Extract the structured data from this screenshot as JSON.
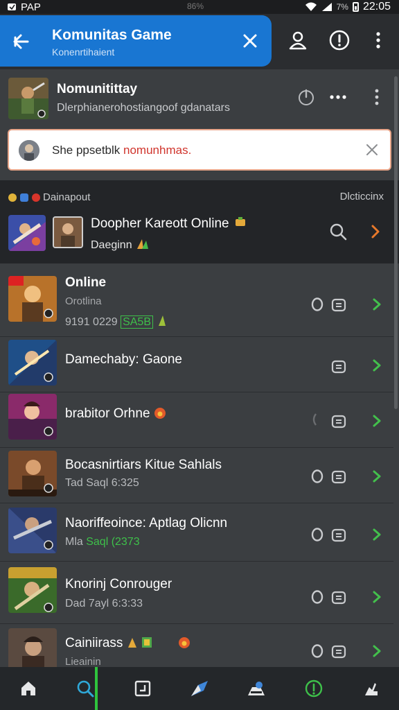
{
  "status_bar": {
    "carrier": "PAP",
    "center_text": "86%",
    "battery_percent": "7%",
    "time": "22:05"
  },
  "header": {
    "title": "Komunitas Game",
    "subtitle": "Konenrtihaient"
  },
  "community": {
    "title": "Nomunitittay",
    "subtitle": "Dlerphianerohostiangoof gdanatars"
  },
  "notice": {
    "text_prefix": "She ppsetblk ",
    "text_highlight": "nomunhmas."
  },
  "featured": {
    "header_left": "Dainapout",
    "header_right": "Dlcticcinx",
    "title": "Doopher Kareott Online",
    "subtitle": "Daeginn"
  },
  "games": [
    {
      "title": "Online",
      "sub": "Orotlina",
      "meta_prefix": "9191 0229 ",
      "meta_green": "SA5B",
      "has_o": true
    },
    {
      "title": "Damechaby: Gaone",
      "sub": "",
      "meta_prefix": "",
      "meta_green": "",
      "has_o": false
    },
    {
      "title": "brabitor Orhne",
      "sub": "",
      "meta_prefix": "",
      "meta_green": "",
      "has_o": false
    },
    {
      "title": "Bocasnirtiars Kitue Sahlals",
      "sub": "",
      "meta_prefix": "Tad Saql 6:325",
      "meta_green": "",
      "has_o": true
    },
    {
      "title": "Naoriffeoince: Aptlag Olicnn",
      "sub": "",
      "meta_prefix": "Mla ",
      "meta_green": "Saql (2373",
      "has_o": true
    },
    {
      "title": "Knorinj Conrouger",
      "sub": "",
      "meta_prefix": "Dad 7ayl 6:3:33",
      "meta_green": "",
      "has_o": true
    },
    {
      "title": "Cainiirass",
      "sub": "Lieainin",
      "meta_prefix": "",
      "meta_green": "",
      "has_o": true
    }
  ],
  "bottom_nav": [
    {
      "icon": "home-icon"
    },
    {
      "icon": "search-icon"
    },
    {
      "icon": "board-icon"
    },
    {
      "icon": "tag-icon"
    },
    {
      "icon": "games-icon"
    },
    {
      "icon": "info-icon"
    },
    {
      "icon": "user-icon"
    }
  ],
  "colors": {
    "header_blue": "#1976d2",
    "accent_green": "#2fc43d",
    "accent_orange": "#e8792b",
    "notice_border": "#e9a68a"
  }
}
